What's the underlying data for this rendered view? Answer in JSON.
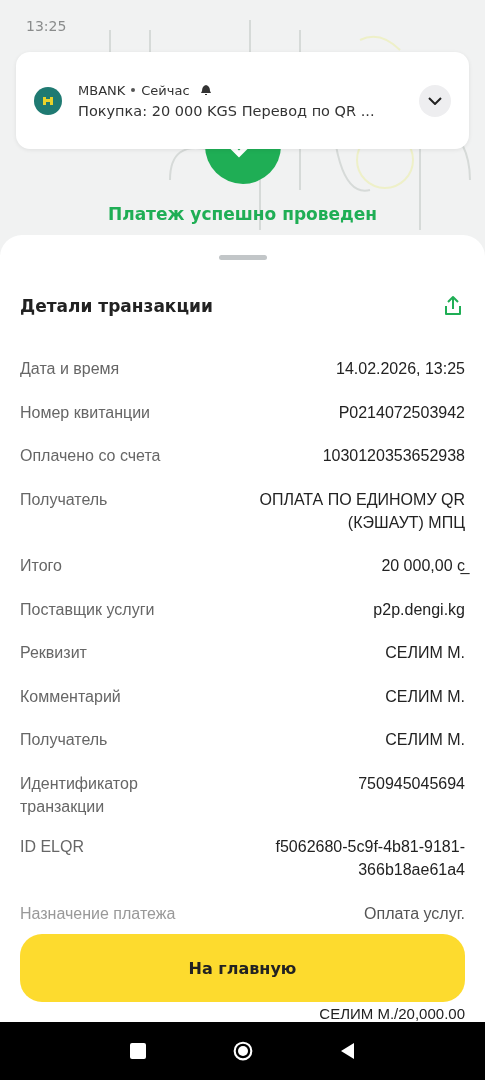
{
  "status_bar": {
    "time": "13:25"
  },
  "notification": {
    "app": "MBANK",
    "time": "Сейчас",
    "text": "Покупка: 20 000 KGS Перевод по QR ..."
  },
  "success": {
    "title": "Платеж успешно проведен"
  },
  "details": {
    "title": "Детали транзакции",
    "rows": [
      {
        "label": "Дата и время",
        "value": "14.02.2026, 13:25"
      },
      {
        "label": "Номер квитанции",
        "value": "P0214072503942"
      },
      {
        "label": "Оплачено со счета",
        "value": "1030120353652938"
      },
      {
        "label": "Получатель",
        "value": "ОПЛАТА ПО ЕДИНОМУ QR (КЭШАУТ) МПЦ"
      },
      {
        "label": "Итого",
        "value": "20 000,00 с̲"
      },
      {
        "label": "Поставщик услуги",
        "value": "p2p.dengi.kg"
      },
      {
        "label": "Реквизит",
        "value": "СЕЛИМ М."
      },
      {
        "label": "Комментарий",
        "value": "СЕЛИМ М."
      },
      {
        "label": "Получатель",
        "value": "СЕЛИМ М."
      },
      {
        "label": "Идентификатор транзакции",
        "value": "750945045694"
      },
      {
        "label": "ID ELQR",
        "value": "f5062680-5c9f-4b81-9181-366b18ae61a4"
      }
    ],
    "purpose": {
      "label": "Назначение платежа",
      "lines": [
        "Оплата услуг.",
        "СЕЛИМ М./20,000.00"
      ]
    }
  },
  "home_button": {
    "label": "На главную"
  }
}
